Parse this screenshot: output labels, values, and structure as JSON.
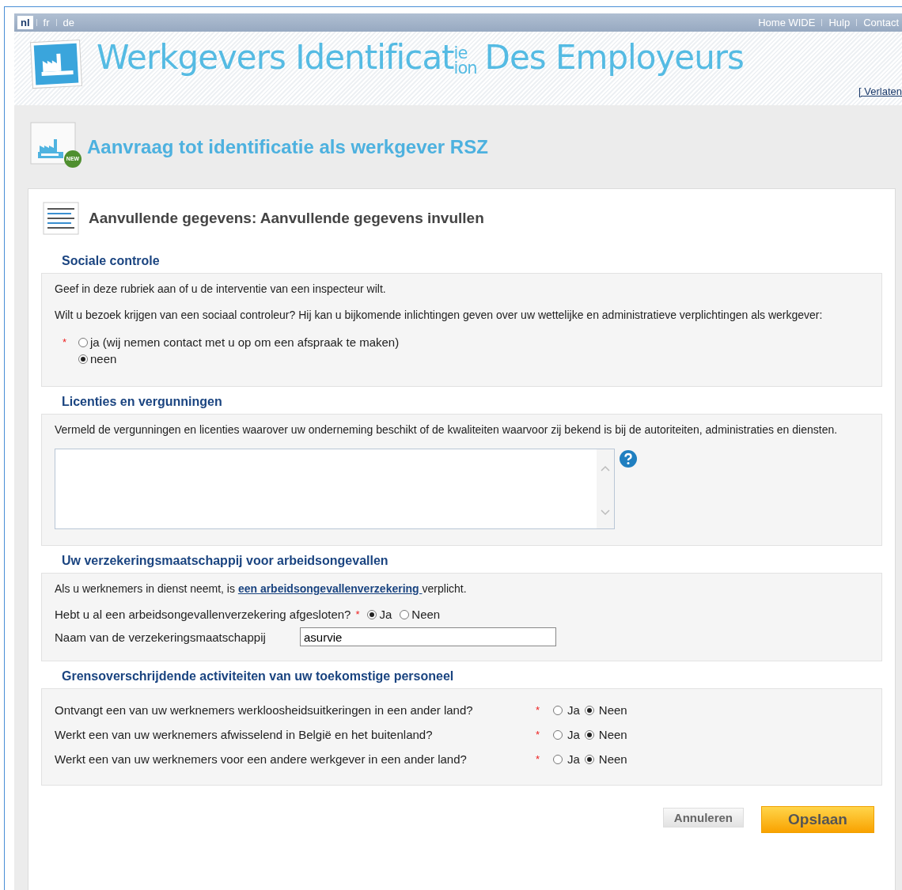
{
  "language_bar": {
    "languages": [
      {
        "label": "nl",
        "selected": true
      },
      {
        "label": "fr",
        "selected": false
      },
      {
        "label": "de",
        "selected": false
      }
    ],
    "links": [
      "Home WIDE",
      "Hulp",
      "Contact"
    ]
  },
  "logo": {
    "text_start": "Werkgevers Identificat",
    "superscript": "ie",
    "subscript": "ion",
    "text_end": "Des Employeurs"
  },
  "leave_link": "[ Verlaten",
  "page_title": {
    "text": "Aanvraag tot identificatie als werkgever RSZ",
    "badge": "NEW"
  },
  "form": {
    "title": "Aanvullende gegevens: Aanvullende gegevens invullen",
    "sections": [
      {
        "heading": "Sociale controle",
        "items": [
          {
            "kind": "paragraph",
            "text": "Geef in deze rubriek aan of u de interventie van een inspecteur wilt."
          },
          {
            "kind": "paragraph",
            "text": "Wilt u bezoek krijgen van een sociaal controleur? Hij kan u bijkomende inlichtingen geven over uw wettelijke en administratieve verplichtingen als werkgever:"
          },
          {
            "kind": "radio_list",
            "required_mark": "*",
            "options": [
              {
                "label": "ja (wij nemen contact met u op om een afspraak te maken)",
                "selected": false
              },
              {
                "label": "neen",
                "selected": true
              }
            ]
          }
        ]
      },
      {
        "heading": "Licenties en vergunningen",
        "items": [
          {
            "kind": "paragraph",
            "text": "Vermeld de vergunningen en licenties waarover uw onderneming beschikt of de kwaliteiten waarvoor zij bekend is bij de autoriteiten, administraties en diensten."
          },
          {
            "kind": "textarea"
          }
        ]
      },
      {
        "heading": "Uw verzekeringsmaatschappij voor arbeidsongevallen",
        "items": [
          {
            "kind": "paragraph_link",
            "before": "Als u werknemers in dienst neemt, is ",
            "link": "een arbeidsongevallenverzekering ",
            "after": "verplicht."
          },
          {
            "kind": "inline_question",
            "label": "Hebt u al een arbeidsongevallenverzekering afgesloten?",
            "required_mark": "*",
            "options": [
              {
                "label": "Ja",
                "selected": true
              },
              {
                "label": "Neen",
                "selected": false
              }
            ]
          },
          {
            "kind": "text_field",
            "label": "Naam van de verzekeringsmaatschappij",
            "value": "asurvie"
          }
        ]
      },
      {
        "heading": "Grensoverschrijdende activiteiten van uw toekomstige personeel",
        "items": [
          {
            "kind": "aligned_question",
            "label": "Ontvangt een van uw werknemers werkloosheidsuitkeringen in een ander land?",
            "required_mark": "*",
            "options": [
              {
                "label": "Ja",
                "selected": false
              },
              {
                "label": "Neen",
                "selected": true
              }
            ]
          },
          {
            "kind": "aligned_question",
            "label": "Werkt een van uw werknemers afwisselend in België en het buitenland?",
            "required_mark": "*",
            "options": [
              {
                "label": "Ja",
                "selected": false
              },
              {
                "label": "Neen",
                "selected": true
              }
            ]
          },
          {
            "kind": "aligned_question",
            "label": "Werkt een van uw werknemers voor een andere werkgever in een ander land?",
            "required_mark": "*",
            "options": [
              {
                "label": "Ja",
                "selected": false
              },
              {
                "label": "Neen",
                "selected": true
              }
            ]
          }
        ]
      }
    ]
  },
  "buttons": [
    {
      "label": "Annuleren",
      "kind": "secondary"
    },
    {
      "label": "Opslaan",
      "kind": "primary"
    }
  ]
}
